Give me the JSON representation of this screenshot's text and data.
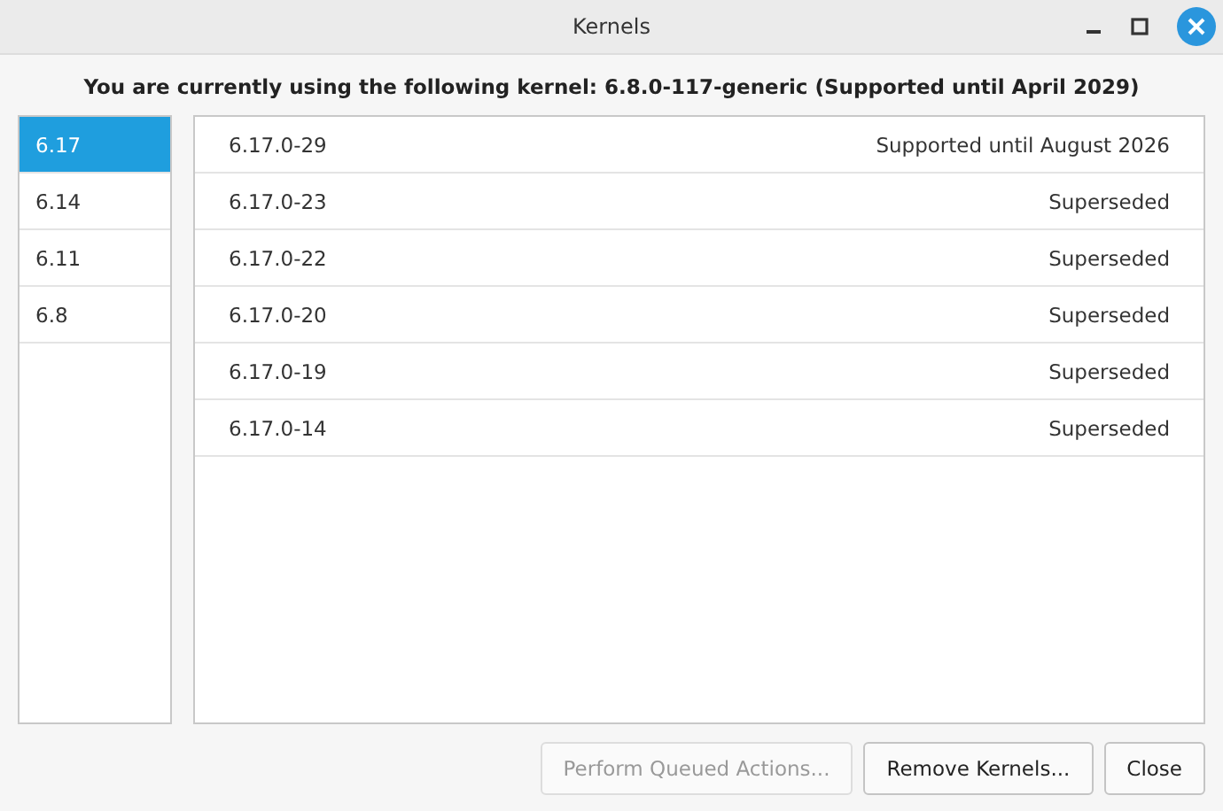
{
  "window": {
    "title": "Kernels"
  },
  "heading": "You are currently using the following kernel: 6.8.0-117-generic (Supported until April 2029)",
  "series": [
    {
      "label": "6.17",
      "selected": true
    },
    {
      "label": "6.14",
      "selected": false
    },
    {
      "label": "6.11",
      "selected": false
    },
    {
      "label": "6.8",
      "selected": false
    }
  ],
  "kernels": [
    {
      "version": "6.17.0-29",
      "status": "Supported until August 2026"
    },
    {
      "version": "6.17.0-23",
      "status": "Superseded"
    },
    {
      "version": "6.17.0-22",
      "status": "Superseded"
    },
    {
      "version": "6.17.0-20",
      "status": "Superseded"
    },
    {
      "version": "6.17.0-19",
      "status": "Superseded"
    },
    {
      "version": "6.17.0-14",
      "status": "Superseded"
    }
  ],
  "buttons": [
    {
      "label": "Perform Queued Actions...",
      "disabled": true
    },
    {
      "label": "Remove Kernels...",
      "disabled": false
    },
    {
      "label": "Close",
      "disabled": false
    }
  ]
}
